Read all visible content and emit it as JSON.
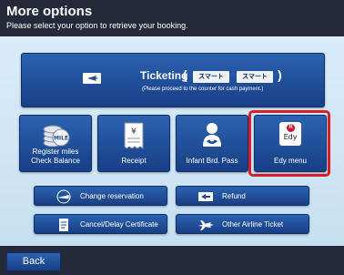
{
  "header": {
    "title": "More options",
    "subtitle": "Please select your option to retrieve your booking."
  },
  "ticketing": {
    "label": "Ticketing",
    "paren_open": "(",
    "paren_close": ")",
    "logo_left": "スマートEC",
    "logo_right": "スマートU25",
    "note": "(Please proceed to the counter for cash payment.)",
    "icon": "ticket-icon"
  },
  "big_buttons": [
    {
      "label_line1": "Register miles",
      "label_line2": "Check Balance",
      "icon": "mile-coins-icon"
    },
    {
      "label": "Receipt",
      "icon": "receipt-icon"
    },
    {
      "label": "Infant Brd. Pass",
      "icon": "infant-icon"
    },
    {
      "label": "Edy menu",
      "icon": "edy-card-icon",
      "card_text": "Edy",
      "card_mark": "R"
    }
  ],
  "small_buttons": [
    {
      "label": "Change reservation",
      "icon": "airplane-icon"
    },
    {
      "label": "Refund",
      "icon": "refund-icon"
    },
    {
      "label": "Cancel/Delay Certificate",
      "icon": "certificate-icon"
    },
    {
      "label": "Other Airline Ticket",
      "icon": "other-airline-icon"
    }
  ],
  "footer": {
    "back_label": "Back"
  },
  "colors": {
    "header_bg": "#242a3a",
    "button_blue": "#1e4c98",
    "content_bg": "#cfe6f5",
    "highlight_red": "#d81e2a",
    "edy_red": "#c8102e"
  }
}
